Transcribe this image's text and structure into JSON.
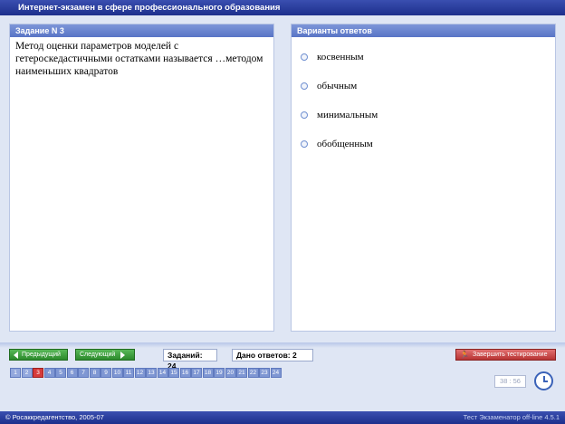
{
  "window": {
    "title": "Интернет-экзамен в сфере профессионального образования"
  },
  "question": {
    "header": "Задание N 3",
    "text": "Метод оценки параметров моделей с гетероскедастичными остатками называется …методом наименьших квадратов"
  },
  "answers": {
    "header": "Варианты ответов",
    "options": [
      "косвенным",
      "обычным",
      "минимальным",
      "обобщенным"
    ]
  },
  "navigation": {
    "prev_label": "Предыдущий",
    "next_label": "Следующий",
    "tasks_count_label": "Заданий: 24",
    "answered_label": "Дано ответов: 2",
    "finish_label": "Завершить тестирование",
    "current_page": 3,
    "pages": [
      "1",
      "2",
      "3",
      "4",
      "5",
      "6",
      "7",
      "8",
      "9",
      "10",
      "11",
      "12",
      "13",
      "14",
      "15",
      "16",
      "17",
      "18",
      "19",
      "20",
      "21",
      "22",
      "23",
      "24"
    ]
  },
  "timer": {
    "value": "38 : 56"
  },
  "footer": {
    "copyright": "© Росаккредагентство, 2005-07",
    "version": "Тест Экзаменатор off-line 4.5.1"
  },
  "colors": {
    "accent": "#1d2f8c",
    "panel_header": "#5874c6",
    "green_button": "#2c8a2c",
    "red_button": "#b73434",
    "current_page": "#d63b3b"
  }
}
